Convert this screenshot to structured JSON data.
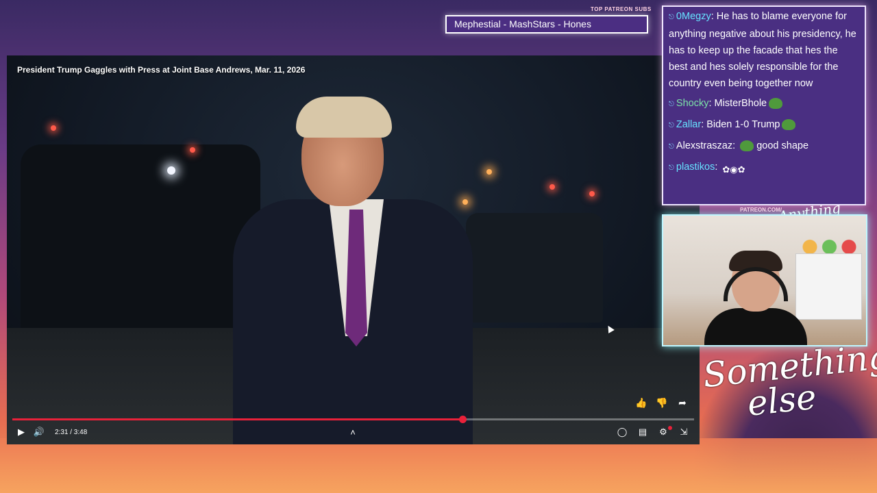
{
  "video": {
    "title": "President Trump Gaggles with Press at Joint Base Andrews, Mar. 11, 2026",
    "time_display": "2:31 / 3:48",
    "progress_fraction": 0.66,
    "progress_color": "#e8213a"
  },
  "actions": {
    "like_icon": "thumbs-up-icon",
    "dislike_icon": "thumbs-down-icon",
    "share_icon": "share-icon"
  },
  "controls": {
    "play_icon": "play-icon",
    "volume_icon": "volume-icon",
    "chevron_icon": "chevron-up-icon",
    "autoplay_icon": "autoplay-toggle-icon",
    "captions_icon": "captions-icon",
    "settings_icon": "settings-icon",
    "exit_fullscreen_icon": "exit-fullscreen-icon"
  },
  "patreon": {
    "label": "TOP PATREON SUBS",
    "ticker": "Mephestial - MashStars - Hones",
    "url": "PATREON.COM/"
  },
  "chat": {
    "messages": [
      {
        "user": "0Megzy",
        "text": "He has to blame everyone for anything negative about his presidency, he has to keep up the facade that hes the best and hes solely responsible for the country even being together now",
        "user_color": "#66e1ff"
      },
      {
        "user": "Shocky",
        "text": "MisterBhole",
        "user_color": "#7de3a8",
        "emote": "pepe-emote"
      },
      {
        "user": "Zallar",
        "text": "Biden 1-0 Trump",
        "user_color": "#66e1ff",
        "emote": "pepe-emote"
      },
      {
        "user": "Alexstraszaz",
        "text": "good shape",
        "user_color": "#ffffff",
        "emote_before": "pepe-emote"
      },
      {
        "user": "plastikos",
        "text": "",
        "user_color": "#66e1ff",
        "emote": "winged-emote"
      }
    ]
  },
  "brand": {
    "small": "Anything else?",
    "big_line1": "Something",
    "big_line2": "else"
  }
}
